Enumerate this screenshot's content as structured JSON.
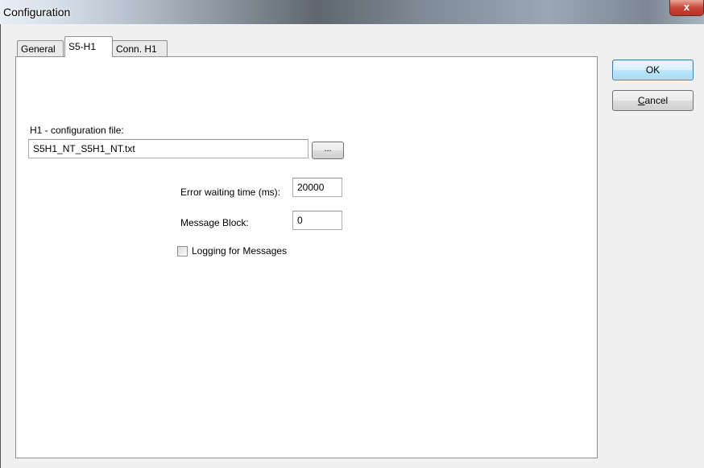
{
  "window": {
    "title": "Configuration",
    "close_label": "x"
  },
  "tabs": [
    {
      "label": "General"
    },
    {
      "label": "S5-H1"
    },
    {
      "label": "Conn. H1"
    }
  ],
  "config_file": {
    "label": "H1 - configuration file:",
    "value": "S5H1_NT_S5H1_NT.txt",
    "browse_label": "..."
  },
  "error_wait": {
    "label": "Error waiting time (ms):",
    "value": "20000"
  },
  "message_block": {
    "label": "Message Block:",
    "value": "0"
  },
  "logging": {
    "label": "Logging  for Messages",
    "checked": false
  },
  "buttons": {
    "ok": "OK",
    "cancel": "Cancel"
  },
  "colors": {
    "ok_accent": "#3c7fb1",
    "close_red": "#c8473a"
  }
}
